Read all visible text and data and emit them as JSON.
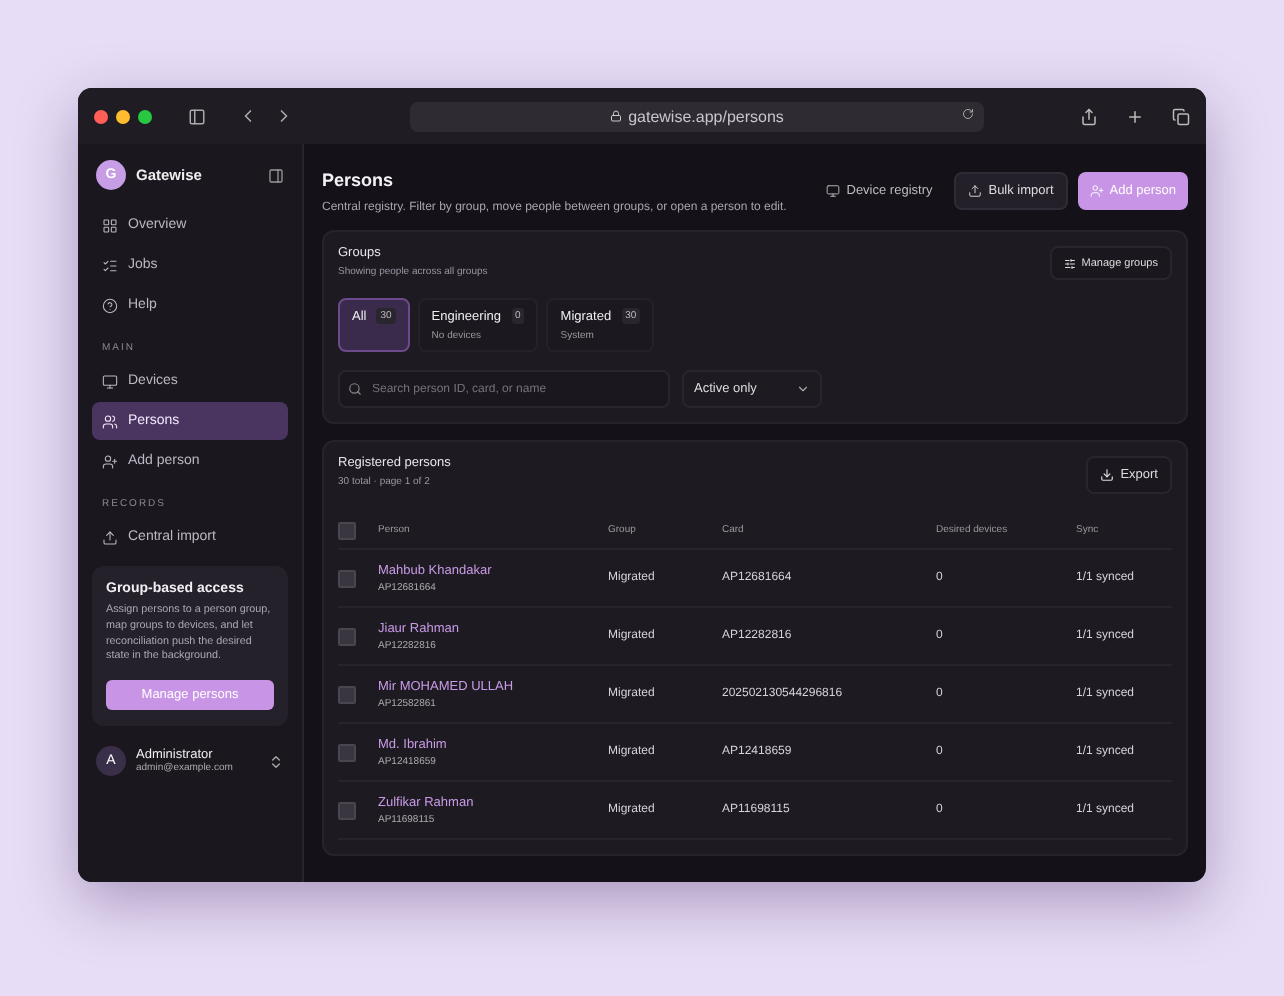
{
  "browser": {
    "url": "gatewise.app/persons"
  },
  "sidebar": {
    "brand": {
      "initial": "G",
      "name": "Gatewise"
    },
    "sections": [
      {
        "items": [
          {
            "label": "Overview",
            "selected": false
          },
          {
            "label": "Jobs",
            "selected": false
          },
          {
            "label": "Help",
            "selected": false
          }
        ]
      },
      {
        "heading": "MAIN",
        "items": [
          {
            "label": "Devices",
            "selected": false
          },
          {
            "label": "Persons",
            "selected": true
          },
          {
            "label": "Add person",
            "selected": false
          }
        ]
      },
      {
        "heading": "RECORDS",
        "items": [
          {
            "label": "Central import",
            "selected": false
          }
        ]
      }
    ],
    "promo": {
      "title": "Group-based access",
      "text": "Assign persons to a person group, map groups to devices, and let reconciliation push the desired state in the background.",
      "button": "Manage persons"
    },
    "user": {
      "initial": "A",
      "name": "Administrator",
      "email": "admin@example.com"
    }
  },
  "header": {
    "title": "Persons",
    "subtitle": "Central registry. Filter by group, move people between groups, or open a person to edit.",
    "actions": [
      {
        "label": "Device registry",
        "kind": "ghost"
      },
      {
        "label": "Bulk import",
        "kind": "secondary"
      },
      {
        "label": "Add person",
        "kind": "primary"
      }
    ]
  },
  "groups": {
    "title": "Groups",
    "subtitle": "Showing people across all groups",
    "manage_button": "Manage groups",
    "items": [
      {
        "name": "All",
        "count": "30",
        "selected": true
      },
      {
        "name": "Engineering",
        "count": "0",
        "note": "No devices",
        "selected": false
      },
      {
        "name": "Migrated",
        "count": "30",
        "note": "System",
        "selected": false
      }
    ],
    "search": {
      "placeholder": "Search person ID, card, or name"
    },
    "filter": {
      "value": "Active only"
    }
  },
  "table": {
    "title": "Registered persons",
    "subtitle": "30 total · page 1 of 2",
    "export_button": "Export",
    "select_all_checked": false,
    "columns": [
      "Person",
      "Group",
      "Card",
      "Desired devices",
      "Sync"
    ],
    "rows": [
      {
        "name": "Mahbub Khandakar",
        "id": "AP12681664",
        "group": "Migrated",
        "card": "AP12681664",
        "desired": "0",
        "sync": "1/1 synced",
        "checked": false
      },
      {
        "name": "Jiaur Rahman",
        "id": "AP12282816",
        "group": "Migrated",
        "card": "AP12282816",
        "desired": "0",
        "sync": "1/1 synced",
        "checked": false
      },
      {
        "name": "Mir MOHAMED ULLAH",
        "id": "AP12582861",
        "group": "Migrated",
        "card": "202502130544296816",
        "desired": "0",
        "sync": "1/1 synced",
        "checked": false
      },
      {
        "name": "Md. Ibrahim",
        "id": "AP12418659",
        "group": "Migrated",
        "card": "AP12418659",
        "desired": "0",
        "sync": "1/1 synced",
        "checked": false
      },
      {
        "name": "Zulfikar Rahman",
        "id": "AP11698115",
        "group": "Migrated",
        "card": "AP11698115",
        "desired": "0",
        "sync": "1/1 synced",
        "checked": false
      }
    ]
  }
}
